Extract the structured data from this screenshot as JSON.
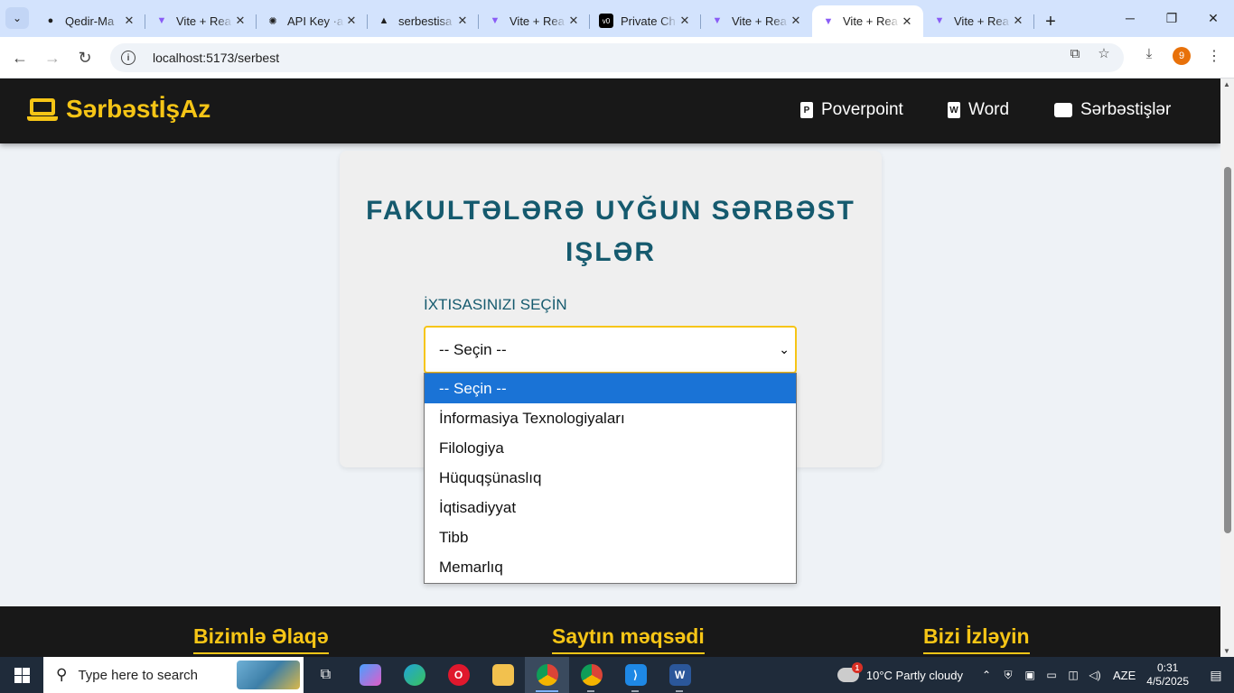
{
  "browser": {
    "tabs": [
      {
        "title": "Qedir-Ma",
        "icon": "github-icon",
        "active": false
      },
      {
        "title": "Vite + Rea",
        "icon": "vite-icon",
        "active": false
      },
      {
        "title": "API Key ·a",
        "icon": "openai-icon",
        "active": false
      },
      {
        "title": "serbestisa",
        "icon": "vercel-icon",
        "active": false
      },
      {
        "title": "Vite + Rea",
        "icon": "vite-icon",
        "active": false
      },
      {
        "title": "Private Ch",
        "icon": "v0-icon",
        "active": false
      },
      {
        "title": "Vite + Rea",
        "icon": "vite-icon",
        "active": false
      },
      {
        "title": "Vite + Rea",
        "icon": "vite-icon",
        "active": true
      },
      {
        "title": "Vite + Rea",
        "icon": "vite-icon",
        "active": false
      }
    ],
    "url": "localhost:5173/serbest",
    "profile_initial": "9"
  },
  "site": {
    "brand": "SərbəstİşAz",
    "nav": [
      {
        "label": "Poverpoint",
        "icon": "powerpoint-file-icon"
      },
      {
        "label": "Word",
        "icon": "word-file-icon"
      },
      {
        "label": "Sərbəstişlər",
        "icon": "briefcase-icon"
      }
    ],
    "heading": "FAKULTƏLƏRƏ UYĞUN SƏRBƏST IŞLƏR",
    "select_label": "İXTISASINIZI SEÇİN",
    "select_value": "-- Seçin --",
    "options": [
      "-- Seçin --",
      "İnformasiya Texnologiyaları",
      "Filologiya",
      "Hüquqşünaslıq",
      "İqtisadiyyat",
      "Tibb",
      "Memarlıq"
    ],
    "footer": {
      "contact": "Bizimlə Əlaqə",
      "purpose": "Saytın məqsədi",
      "follow": "Bizi İzləyin"
    }
  },
  "taskbar": {
    "search_placeholder": "Type here to search",
    "weather": "10°C  Partly cloudy",
    "weather_badge": "1",
    "language": "AZE",
    "time": "0:31",
    "date": "4/5/2025"
  },
  "colors": {
    "accent": "#f6c516",
    "heading": "#155a6e",
    "header_bg": "#181818",
    "selected_option": "#1a73d6"
  }
}
